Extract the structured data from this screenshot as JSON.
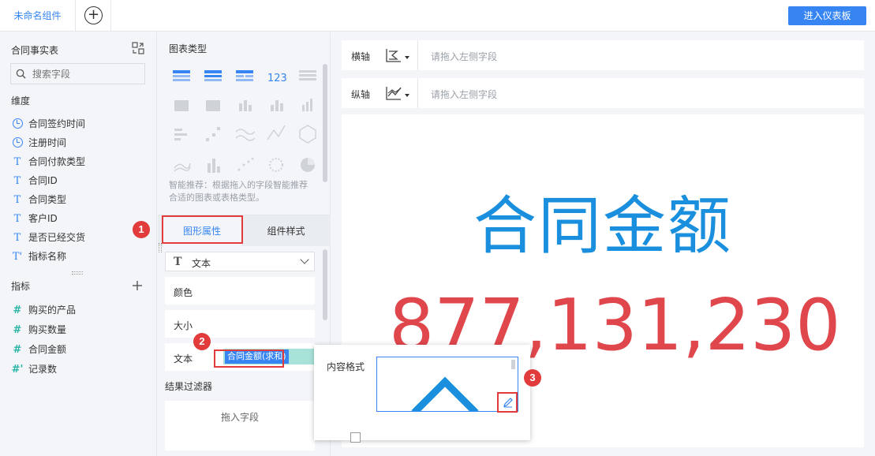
{
  "topbar": {
    "tab_label": "未命名组件",
    "add_symbol": "+",
    "dashboard_button": "进入仪表板"
  },
  "left_panel": {
    "title": "合同事实表",
    "search_placeholder": "搜索字段",
    "dimensions_label": "维度",
    "dimensions": [
      {
        "icon": "clock-icon",
        "label": "合同签约时间"
      },
      {
        "icon": "clock-icon",
        "label": "注册时间"
      },
      {
        "icon": "text-type-icon",
        "glyph": "T",
        "label": "合同付款类型"
      },
      {
        "icon": "text-type-icon",
        "glyph": "T",
        "label": "合同ID"
      },
      {
        "icon": "text-type-icon",
        "glyph": "T",
        "label": "合同类型"
      },
      {
        "icon": "text-type-icon",
        "glyph": "T",
        "label": "客户ID"
      },
      {
        "icon": "text-type-icon",
        "glyph": "T",
        "label": "是否已经交货"
      },
      {
        "icon": "text-type-icon",
        "glyph": "T'",
        "label": "指标名称"
      }
    ],
    "metrics_label": "指标",
    "metrics": [
      {
        "icon": "number-type-icon",
        "glyph": "#",
        "label": "购买的产品"
      },
      {
        "icon": "number-type-icon",
        "glyph": "#",
        "label": "购买数量"
      },
      {
        "icon": "number-type-icon",
        "glyph": "#",
        "label": "合同金额"
      },
      {
        "icon": "number-type-icon",
        "glyph": "#'",
        "label": "记录数"
      }
    ]
  },
  "middle_panel": {
    "chart_type_title": "图表类型",
    "recommend_hint": "智能推荐：根据拖入的字段智能推荐合适的图表或表格类型。",
    "tab_graph_props": "图形属性",
    "tab_component_style": "组件样式",
    "mark_type_glyph": "T",
    "mark_type": "文本",
    "prop_color": "颜色",
    "prop_size": "大小",
    "prop_text": "文本",
    "text_field": "合同金额(求和)",
    "filter_title": "结果过滤器",
    "filter_drop": "拖入字段"
  },
  "right_panel": {
    "x_axis_label": "横轴",
    "x_axis_placeholder": "请拖入左侧字段",
    "y_axis_label": "纵轴",
    "y_axis_placeholder": "请拖入左侧字段",
    "big_title": "合同金额",
    "big_value": "877,131,230",
    "title_color": "#1a8fde",
    "value_color": "#e0474c"
  },
  "popup": {
    "label": "内容格式"
  },
  "badges": [
    "1",
    "2",
    "3"
  ],
  "colors": {
    "accent": "#3685f2",
    "highlight": "#e23b3b",
    "pill": "#a8e3da"
  }
}
